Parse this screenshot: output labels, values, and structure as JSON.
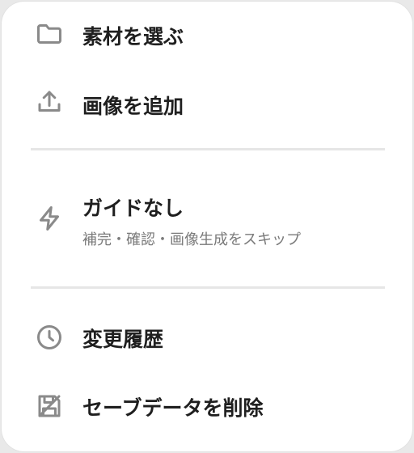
{
  "menu": {
    "items": [
      {
        "icon": "folder-icon",
        "label": "素材を選ぶ"
      },
      {
        "icon": "upload-icon",
        "label": "画像を追加"
      },
      {
        "icon": "lightning-icon",
        "label": "ガイドなし",
        "sublabel": "補完・確認・画像生成をスキップ"
      },
      {
        "icon": "clock-icon",
        "label": "変更履歴"
      },
      {
        "icon": "save-delete-icon",
        "label": "セーブデータを削除"
      }
    ]
  }
}
